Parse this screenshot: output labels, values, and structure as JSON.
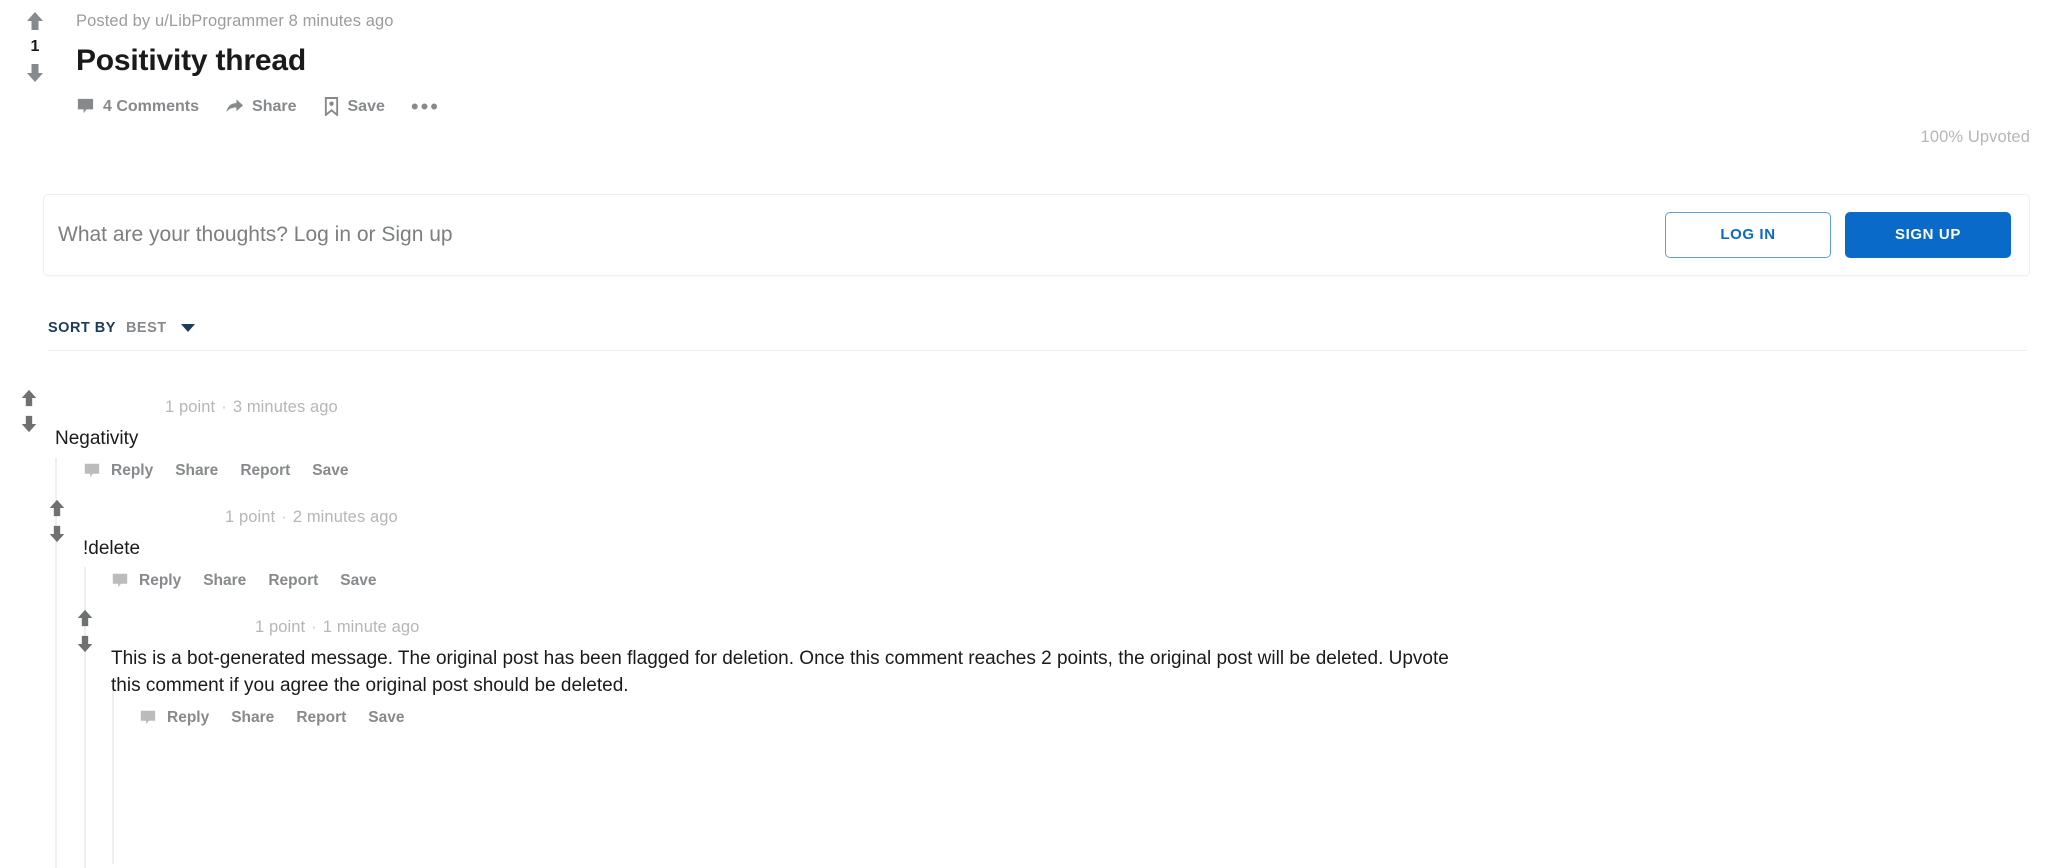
{
  "post": {
    "vote_count": "1",
    "meta": "Posted by u/LibProgrammer 8 minutes ago",
    "title": "Positivity thread",
    "upvoted_percent": "100% Upvoted",
    "actions": [
      {
        "label": "4 Comments",
        "icon": "comment-bubble-icon"
      },
      {
        "label": "Share",
        "icon": "share-arrow-icon"
      },
      {
        "label": "Save",
        "icon": "bookmark-icon"
      }
    ],
    "more_label": "•••"
  },
  "comment_box": {
    "placeholder": "What are your thoughts? Log in or Sign up",
    "login_label": "LOG IN",
    "signup_label": "SIGN UP"
  },
  "sort": {
    "label": "SORT BY",
    "value": "BEST",
    "caret_icon": "chevron-down-icon"
  },
  "comment_actions": [
    "Reply",
    "Share",
    "Report",
    "Save"
  ],
  "comments": [
    {
      "points": "1 point",
      "age": "3 minutes ago",
      "body": "Negativity"
    },
    {
      "points": "1 point",
      "age": "2 minutes ago",
      "body": "!delete"
    },
    {
      "points": "1 point",
      "age": "1 minute ago",
      "body_line1": "This is a bot-generated message. The original post has been flagged for deletion. Once this comment reaches 2 points,",
      "body_line2": "the original post will be deleted. Upvote this comment if you agree the original post should be deleted."
    }
  ],
  "colors": {
    "accent_blue": "#0a6ac9",
    "text_primary": "#1a1a1b",
    "text_muted": "#878a8c",
    "text_faint": "#b4b6b8",
    "divider": "#edeff1",
    "sort_navy": "#1c3d5a"
  }
}
